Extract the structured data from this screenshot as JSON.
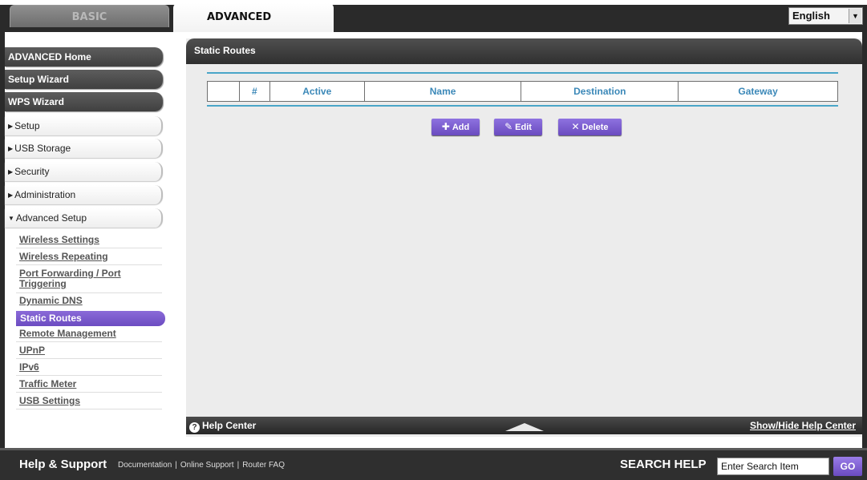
{
  "tabs": {
    "basic": "BASIC",
    "advanced": "ADVANCED"
  },
  "language": {
    "selected": "English"
  },
  "sidebar": {
    "main_items": [
      {
        "label": "ADVANCED Home"
      },
      {
        "label": "Setup Wizard"
      },
      {
        "label": "WPS Wizard"
      }
    ],
    "sections": [
      {
        "label": "Setup"
      },
      {
        "label": "USB Storage"
      },
      {
        "label": "Security"
      },
      {
        "label": "Administration"
      },
      {
        "label": "Advanced Setup"
      }
    ],
    "sub_items": [
      {
        "label": "Wireless Settings"
      },
      {
        "label": "Wireless Repeating"
      },
      {
        "label": "Port Forwarding / Port Triggering"
      },
      {
        "label": "Dynamic DNS"
      },
      {
        "label": "Static Routes"
      },
      {
        "label": "Remote Management"
      },
      {
        "label": "UPnP"
      },
      {
        "label": "IPv6"
      },
      {
        "label": "Traffic Meter"
      },
      {
        "label": "USB Settings"
      }
    ]
  },
  "panel": {
    "title": "Static Routes",
    "table": {
      "columns": [
        "",
        "#",
        "Active",
        "Name",
        "Destination",
        "Gateway"
      ]
    },
    "buttons": {
      "add": "Add",
      "edit": "Edit",
      "delete": "Delete"
    }
  },
  "help_bar": {
    "title": "Help Center",
    "toggle": "Show/Hide Help Center"
  },
  "footer": {
    "title": "Help & Support",
    "links": [
      "Documentation",
      "Online Support",
      "Router FAQ"
    ],
    "search_label": "SEARCH HELP",
    "search_value": "Enter Search Item",
    "go": "GO"
  },
  "colors": {
    "accent_purple": "#7a5acf",
    "table_header_blue": "#3b88b8",
    "rule_blue": "#4aa6c8",
    "dark_bar": "#2f2f2f"
  }
}
